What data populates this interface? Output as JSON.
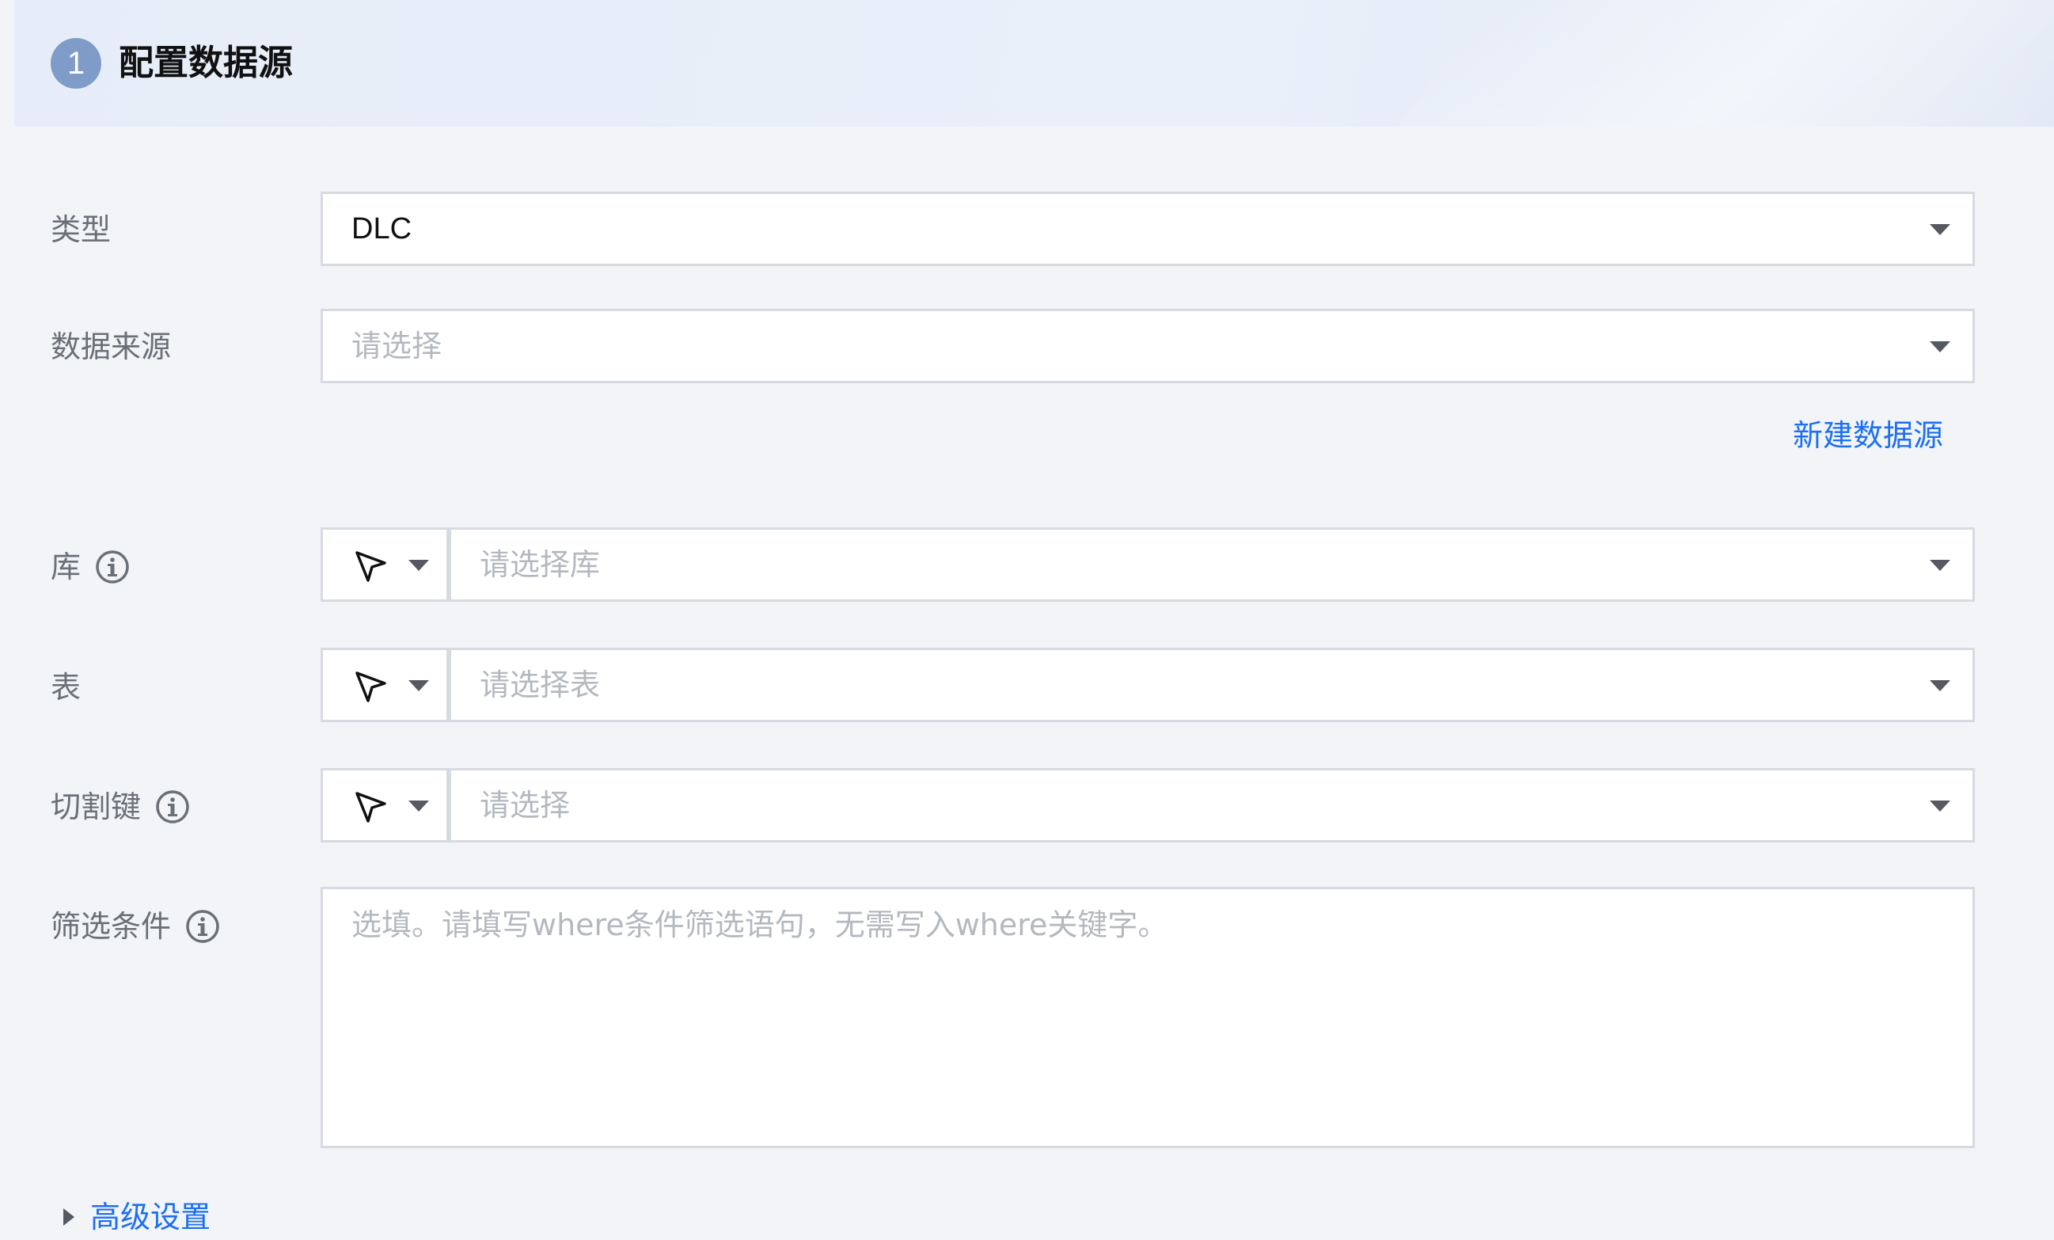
{
  "section": {
    "step_number": "1",
    "title": "配置数据源"
  },
  "form": {
    "type": {
      "label": "类型",
      "value": "DLC"
    },
    "data_source": {
      "label": "数据来源",
      "placeholder": "请选择",
      "new_link": "新建数据源"
    },
    "database": {
      "label": "库",
      "placeholder": "请选择库"
    },
    "table": {
      "label": "表",
      "placeholder": "请选择表"
    },
    "split_key": {
      "label": "切割键",
      "placeholder": "请选择"
    },
    "filter": {
      "label": "筛选条件",
      "placeholder": "选填。请填写where条件筛选语句，无需写入where关键字。"
    }
  },
  "advanced": {
    "label": "高级设置"
  },
  "colors": {
    "accent": "#1d6ff2",
    "step_circle": "#7f9cc8",
    "background": "#f2f4f8",
    "border": "#d6dae1"
  }
}
